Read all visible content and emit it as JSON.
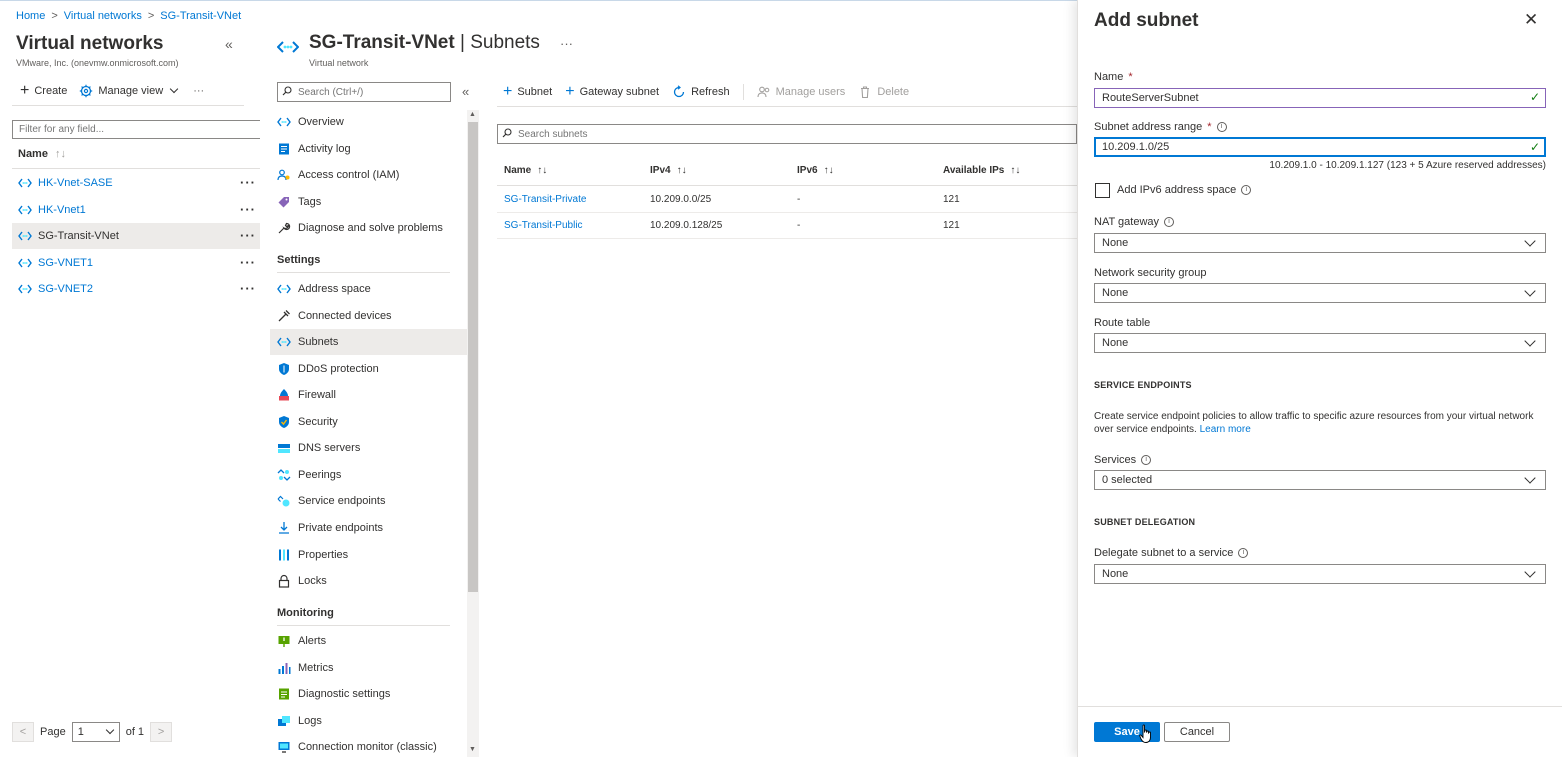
{
  "breadcrumb": [
    "Home",
    "Virtual networks",
    "SG-Transit-VNet"
  ],
  "left": {
    "title": "Virtual networks",
    "subtitle": "VMware, Inc. (onevmw.onmicrosoft.com)",
    "create_label": "Create",
    "manage_view_label": "Manage view",
    "more_label": "···",
    "filter_placeholder": "Filter for any field...",
    "column_name": "Name",
    "vnets": [
      {
        "name": "HK-Vnet-SASE",
        "selected": false
      },
      {
        "name": "HK-Vnet1",
        "selected": false
      },
      {
        "name": "SG-Transit-VNet",
        "selected": true
      },
      {
        "name": "SG-VNET1",
        "selected": false
      },
      {
        "name": "SG-VNET2",
        "selected": false
      }
    ],
    "pager": {
      "page_label": "Page",
      "page_value": "1",
      "of_label": "of 1"
    }
  },
  "resource": {
    "name": "SG-Transit-VNet",
    "section": "Subnets",
    "type": "Virtual network",
    "search_placeholder": "Search (Ctrl+/)"
  },
  "menu": {
    "top": [
      {
        "label": "Overview",
        "icon": "vnet-icon"
      },
      {
        "label": "Activity log",
        "icon": "log-icon"
      },
      {
        "label": "Access control (IAM)",
        "icon": "iam-icon"
      },
      {
        "label": "Tags",
        "icon": "tag-icon"
      },
      {
        "label": "Diagnose and solve problems",
        "icon": "wrench-icon"
      }
    ],
    "settings_header": "Settings",
    "settings": [
      {
        "label": "Address space",
        "icon": "vnet-icon"
      },
      {
        "label": "Connected devices",
        "icon": "plug-icon"
      },
      {
        "label": "Subnets",
        "icon": "vnet-icon",
        "active": true
      },
      {
        "label": "DDoS protection",
        "icon": "shield-icon"
      },
      {
        "label": "Firewall",
        "icon": "firewall-icon"
      },
      {
        "label": "Security",
        "icon": "security-icon"
      },
      {
        "label": "DNS servers",
        "icon": "dns-icon"
      },
      {
        "label": "Peerings",
        "icon": "peering-icon"
      },
      {
        "label": "Service endpoints",
        "icon": "endpoint-icon"
      },
      {
        "label": "Private endpoints",
        "icon": "private-endpoint-icon"
      },
      {
        "label": "Properties",
        "icon": "properties-icon"
      },
      {
        "label": "Locks",
        "icon": "lock-icon"
      }
    ],
    "monitoring_header": "Monitoring",
    "monitoring": [
      {
        "label": "Alerts",
        "icon": "alert-icon"
      },
      {
        "label": "Metrics",
        "icon": "metrics-icon"
      },
      {
        "label": "Diagnostic settings",
        "icon": "diagnostic-icon"
      },
      {
        "label": "Logs",
        "icon": "logs-icon"
      },
      {
        "label": "Connection monitor (classic)",
        "icon": "monitor-icon"
      }
    ]
  },
  "toolbar": {
    "subnet": "Subnet",
    "gateway_subnet": "Gateway subnet",
    "refresh": "Refresh",
    "manage_users": "Manage users",
    "delete": "Delete"
  },
  "subnets": {
    "search_placeholder": "Search subnets",
    "columns": [
      "Name",
      "IPv4",
      "IPv6",
      "Available IPs"
    ],
    "rows": [
      {
        "name": "SG-Transit-Private",
        "ipv4": "10.209.0.0/25",
        "ipv6": "-",
        "available": "121"
      },
      {
        "name": "SG-Transit-Public",
        "ipv4": "10.209.0.128/25",
        "ipv6": "-",
        "available": "121"
      }
    ]
  },
  "blade": {
    "title": "Add subnet",
    "name_label": "Name",
    "name_value": "RouteServerSubnet",
    "range_label": "Subnet address range",
    "range_value": "10.209.1.0/25",
    "range_hint": "10.209.1.0 - 10.209.1.127 (123 + 5 Azure reserved addresses)",
    "ipv6_label": "Add IPv6 address space",
    "nat_label": "NAT gateway",
    "nat_value": "None",
    "nsg_label": "Network security group",
    "nsg_value": "None",
    "route_label": "Route table",
    "route_value": "None",
    "service_endpoints_header": "SERVICE ENDPOINTS",
    "service_endpoints_desc": "Create service endpoint policies to allow traffic to specific azure resources from your virtual network over service endpoints.",
    "learn_more": "Learn more",
    "services_label": "Services",
    "services_value": "0 selected",
    "delegation_header": "SUBNET DELEGATION",
    "delegate_label": "Delegate subnet to a service",
    "delegate_value": "None",
    "save": "Save",
    "cancel": "Cancel"
  },
  "colors": {
    "accent": "#0078d4",
    "success": "#107c10",
    "selected_bg": "#edebe9"
  }
}
